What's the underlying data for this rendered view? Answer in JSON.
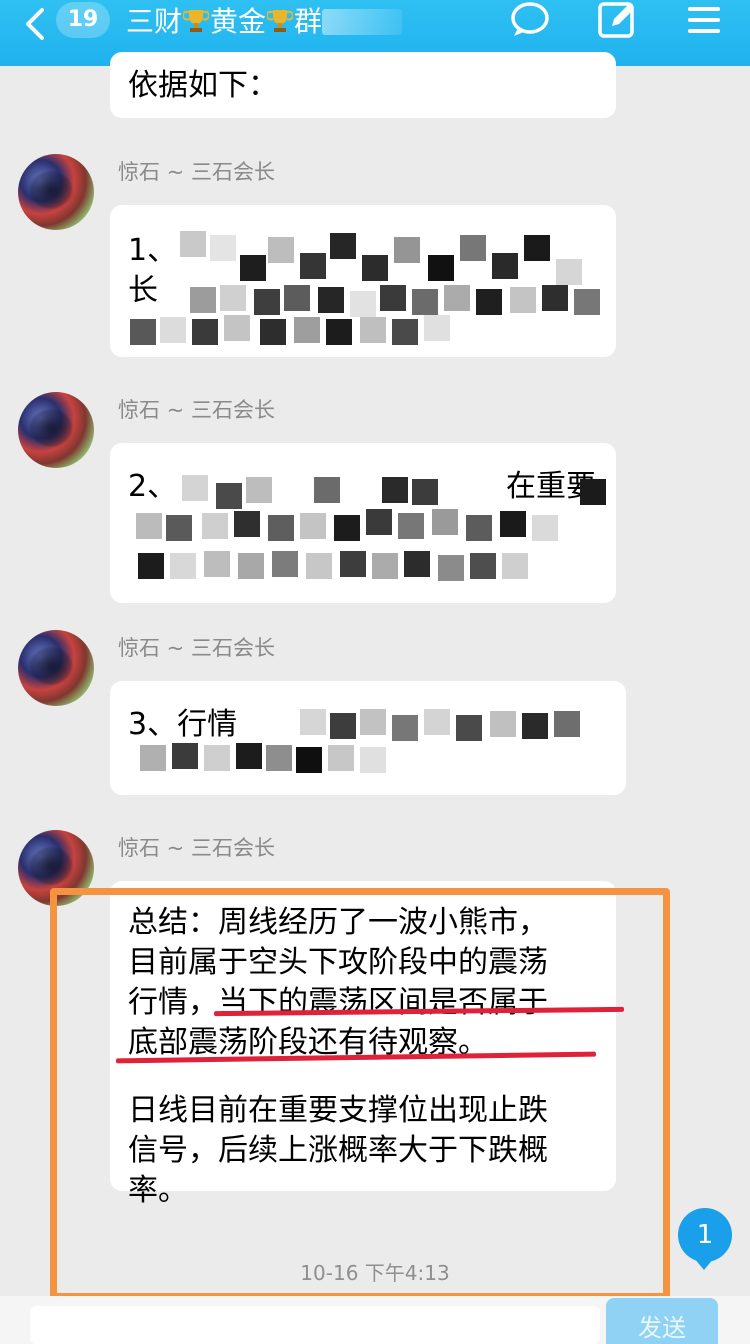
{
  "header": {
    "back_label": "返回",
    "unread_count": "19",
    "title_part1": "三财",
    "title_part2": "黄金",
    "title_part3": "群",
    "icons": [
      "chevron-left-icon",
      "trophy-icon",
      "chat-bubble-icon",
      "edit-icon",
      "menu-icon"
    ],
    "colors": {
      "bar": "#1fb2ee",
      "highlight_box": "#f59440",
      "underline": "#e0213a",
      "unread_badge": "#1aa0ea"
    }
  },
  "messages": [
    {
      "lines": [
        "依据如下："
      ]
    },
    {
      "sender": "惊石 ~ 三石会长",
      "lines": [
        "1、",
        "长"
      ],
      "redacted": true
    },
    {
      "sender": "惊石 ~ 三石会长",
      "lines": [
        "2、",
        "在重要"
      ],
      "redacted": true
    },
    {
      "sender": "惊石 ~ 三石会长",
      "lines": [
        "3、行情"
      ],
      "redacted": true
    },
    {
      "sender": "惊石 ~ 三石会长",
      "lines": [
        "总结：周线经历了一波小熊市，",
        "目前属于空头下攻阶段中的震荡",
        "行情，当下的震荡区间是否属于",
        "底部震荡阶段还有待观察。",
        "",
        "日线目前在重要支撑位出现止跌",
        "信号，后续上涨概率大于下跌概",
        "率。"
      ]
    }
  ],
  "timestamp": "10-16 下午4:13",
  "unread_bubble_count": "1",
  "input": {
    "placeholder": ""
  },
  "send_label": "发送"
}
